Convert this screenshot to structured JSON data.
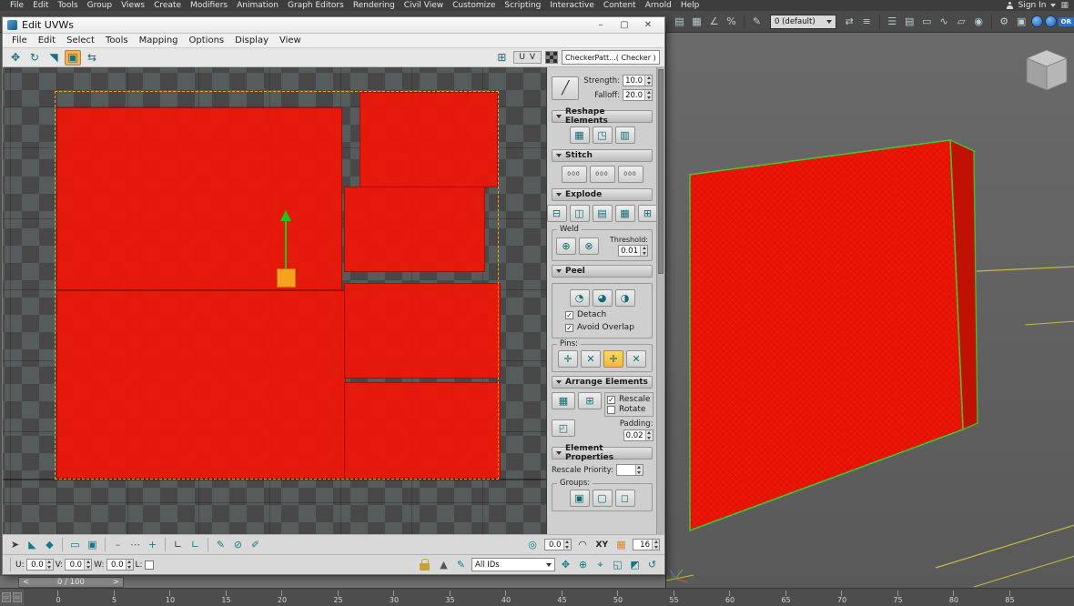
{
  "colors": {
    "red": "#f01406",
    "orange": "#f6a21f",
    "green": "#19c919",
    "teal": "#0f7b84",
    "accent_blue": "#2d72c8",
    "wire_green": "#46c72e",
    "grid_yellow": "#c7b83f"
  },
  "menubar": {
    "items": [
      "File",
      "Edit",
      "Tools",
      "Group",
      "Views",
      "Create",
      "Modifiers",
      "Animation",
      "Graph Editors",
      "Rendering",
      "Civil View",
      "Customize",
      "Scripting",
      "Interactive",
      "Content",
      "Arnold",
      "Help"
    ],
    "sign_in": "Sign In",
    "workspace_icon": "▦"
  },
  "main_toolbar": {
    "left_icons": [
      {
        "name": "selection-filter-icon",
        "glyph": "▤"
      },
      {
        "name": "snaps-toggle-icon",
        "glyph": "▦"
      },
      {
        "name": "angle-snap-icon",
        "glyph": "∠"
      },
      {
        "name": "percent-snap-icon",
        "glyph": "%"
      },
      {
        "sep": true
      },
      {
        "name": "edit-named-sets-icon",
        "glyph": "✎"
      }
    ],
    "selection_set_value": "0 (default)",
    "right_icons": [
      {
        "name": "mirror-icon",
        "glyph": "⇄"
      },
      {
        "name": "align-icon",
        "glyph": "≡"
      },
      {
        "sep": true
      },
      {
        "name": "scene-explorer-icon",
        "glyph": "☰"
      },
      {
        "name": "layer-explorer-icon",
        "glyph": "▤"
      },
      {
        "name": "ribbon-icon",
        "glyph": "▭"
      },
      {
        "name": "curve-editor-icon",
        "glyph": "∿"
      },
      {
        "name": "schematic-view-icon",
        "glyph": "▱"
      },
      {
        "name": "material-editor-icon",
        "glyph": "◉"
      },
      {
        "sep": true
      },
      {
        "name": "render-setup-icon",
        "glyph": "⚙"
      },
      {
        "name": "rendered-frame-icon",
        "glyph": "▣"
      },
      {
        "name": "render-production-icon",
        "glyph": "",
        "circle": true
      },
      {
        "name": "render-iterative-icon",
        "glyph": "",
        "circle": true
      },
      {
        "name": "or-badge-icon",
        "glyph": "OR",
        "badge": true
      }
    ]
  },
  "dialog": {
    "title": "Edit UVWs",
    "window_icons": [
      {
        "name": "minimize-button",
        "glyph": "–"
      },
      {
        "name": "maximize-button",
        "glyph": "▢"
      },
      {
        "name": "close-button",
        "glyph": "✕"
      }
    ],
    "menu_items": [
      "File",
      "Edit",
      "Select",
      "Tools",
      "Mapping",
      "Options",
      "Display",
      "View"
    ],
    "toolbar_icons": [
      {
        "name": "move-tool-icon",
        "glyph": "✥"
      },
      {
        "name": "rotate-tool-icon",
        "glyph": "↻"
      },
      {
        "name": "scale-tool-icon",
        "glyph": "◥"
      },
      {
        "name": "freeform-mode-icon",
        "glyph": "▣",
        "active": true
      },
      {
        "name": "mirror-tool-icon",
        "glyph": "⇆"
      }
    ],
    "toolbar_right_icons": [
      {
        "name": "pixel-snap-icon",
        "glyph": "⊞"
      }
    ],
    "uv_button": "U V",
    "texture_dropdown": "CheckerPatt...( Checker )",
    "panel": {
      "brush": {
        "strength_label": "Strength:",
        "strength_value": "10.0",
        "falloff_label": "Falloff:",
        "falloff_value": "20.0",
        "falloff_curve_icon": "╱"
      },
      "reshape": {
        "title": "Reshape Elements",
        "icons": [
          {
            "name": "relax-until-flat-icon",
            "glyph": "▦"
          },
          {
            "name": "relax-tool-icon",
            "glyph": "◳"
          },
          {
            "name": "straighten-selection-icon",
            "glyph": "▥"
          }
        ]
      },
      "stitch": {
        "title": "Stitch",
        "icons": [
          {
            "name": "stitch-custom-icon",
            "glyph": "000",
            "cls": "dots"
          },
          {
            "name": "stitch-average-icon",
            "glyph": "000",
            "cls": "dots"
          },
          {
            "name": "stitch-target-icon",
            "glyph": "000",
            "cls": "dots"
          }
        ]
      },
      "explode": {
        "title": "Explode",
        "icons": [
          {
            "name": "break-icon",
            "glyph": "⊟"
          },
          {
            "name": "detach-edge-verts-icon",
            "glyph": "◫"
          },
          {
            "name": "flatten-by-angle-icon",
            "glyph": "▤"
          },
          {
            "name": "flatten-mapping-icon",
            "glyph": "▦"
          },
          {
            "name": "flatten-by-material-icon",
            "glyph": "⊞"
          }
        ],
        "weld_label": "Weld",
        "weld_icons": [
          {
            "name": "weld-selected-icon",
            "glyph": "⊕"
          },
          {
            "name": "target-weld-icon",
            "glyph": "⊗"
          }
        ],
        "threshold_label": "Threshold:",
        "threshold_value": "0.01"
      },
      "peel": {
        "title": "Peel",
        "icons": [
          {
            "name": "quick-peel-icon",
            "glyph": "◔"
          },
          {
            "name": "peel-mode-icon",
            "glyph": "◕"
          },
          {
            "name": "lscm-interactive-icon",
            "glyph": "◑"
          }
        ],
        "detach_label": "Detach",
        "avoid_overlap_label": "Avoid Overlap",
        "pins_label": "Pins:",
        "pin_icons": [
          {
            "name": "pin-tool-icon",
            "glyph": "✛"
          },
          {
            "name": "unpin-tool-icon",
            "glyph": "✕"
          },
          {
            "name": "pin-selected-icon",
            "glyph": "✛",
            "hl": true
          },
          {
            "name": "unpin-selected-icon",
            "glyph": "✕"
          }
        ]
      },
      "arrange": {
        "title": "Arrange Elements",
        "icon_pack_normalize": {
          "name": "pack-normalize-icon",
          "glyph": "▦"
        },
        "icon_pack_full": {
          "name": "pack-full-icon",
          "glyph": "⊞"
        },
        "icon_pack_padding": {
          "name": "pack-padding-icon",
          "glyph": "◰"
        },
        "rescale_label": "Rescale",
        "rotate_label": "Rotate",
        "padding_label": "Padding:",
        "padding_value": "0.02"
      },
      "element_properties": {
        "title": "Element Properties",
        "rescale_priority_label": "Rescale Priority:",
        "rescale_priority_value": "",
        "groups_label": "Groups:",
        "group_icons": [
          {
            "name": "group-selected-icon",
            "glyph": "▣"
          },
          {
            "name": "ungroup-icon",
            "glyph": "▢"
          },
          {
            "name": "select-group-icon",
            "glyph": "◻"
          }
        ]
      }
    },
    "bottom1": {
      "icons": [
        {
          "name": "select-arrow-icon",
          "glyph": "➤",
          "color": "#3a3a3a"
        },
        {
          "name": "soft-selection-falloff-icon",
          "glyph": "◣"
        },
        {
          "name": "falloff-space-icon",
          "glyph": "◆"
        },
        {
          "sep": true
        },
        {
          "name": "edge-distance-icon",
          "glyph": "▭"
        },
        {
          "name": "element-mode-icon",
          "glyph": "▣"
        },
        {
          "sep": true
        },
        {
          "name": "paint-dash-icon",
          "glyph": "–"
        },
        {
          "name": "paint-dots-icon",
          "glyph": "⋯"
        },
        {
          "name": "paint-add-icon",
          "glyph": "+"
        },
        {
          "sep": true
        },
        {
          "name": "align-corner-icon",
          "glyph": "∟",
          "color": "#3a3a3a"
        },
        {
          "name": "align-corner-teal-icon",
          "glyph": "∟"
        },
        {
          "sep": true
        },
        {
          "name": "paint-brush-icon",
          "glyph": "✎"
        },
        {
          "name": "paint-erase-icon",
          "glyph": "⊘"
        },
        {
          "name": "paint-options-icon",
          "glyph": "✐"
        }
      ],
      "rotate_gizmo_icon": "◎",
      "angle_value": "0.0",
      "arc_icon": "◠",
      "axis_label": "XY",
      "grid_icon": "▦",
      "grid_value": "16"
    },
    "bottom2": {
      "u_label": "U:",
      "u_value": "0.0",
      "v_label": "V:",
      "v_value": "0.0",
      "w_label": "W:",
      "w_value": "0.0",
      "l_label": "L:",
      "pre_icons": [
        {
          "name": "snap-triangle-icon",
          "glyph": "▲",
          "color": "#555555"
        },
        {
          "name": "paint-select-icon",
          "glyph": "✎"
        }
      ],
      "all_ids": "All IDs",
      "nav_icons": [
        {
          "name": "pan-icon",
          "glyph": "✥"
        },
        {
          "name": "zoom-icon",
          "glyph": "⊕"
        },
        {
          "name": "zoom-region-icon",
          "glyph": "⌖"
        },
        {
          "name": "zoom-extents-icon",
          "glyph": "◱"
        },
        {
          "name": "zoom-selected-icon",
          "glyph": "◩"
        },
        {
          "name": "revert-zoom-icon",
          "glyph": "↺"
        }
      ]
    }
  },
  "trackbar": {
    "prev": "<",
    "value": "0 / 100",
    "next": ">"
  },
  "ruler": {
    "ticks": [
      "0",
      "5",
      "10",
      "15",
      "20",
      "25",
      "30",
      "35",
      "40",
      "45",
      "50",
      "55",
      "60",
      "65",
      "70",
      "75",
      "80",
      "85"
    ]
  },
  "status_icons": [
    {
      "name": "track-mini-icon",
      "glyph": "▭"
    },
    {
      "name": "key-mode-mini-icon",
      "glyph": "▭"
    }
  ]
}
